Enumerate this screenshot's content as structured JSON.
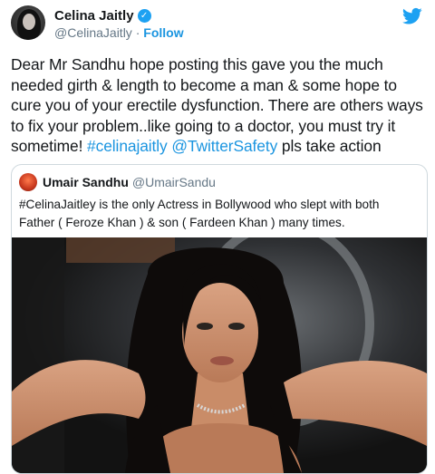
{
  "author": {
    "name": "Celina Jaitly",
    "handle": "@CelinaJaitly",
    "separator": "·",
    "follow_label": "Follow"
  },
  "tweet": {
    "text_part1": "Dear Mr Sandhu hope posting this gave you the much needed girth & length to become a man & some hope to cure you of your erectile dysfunction. There are others ways to fix your problem..like going to a doctor, you must try it sometime! ",
    "hashtag": "#celinajaitly",
    "mention": "@TwitterSafety",
    "text_part2": " pls take action"
  },
  "quoted_tweet": {
    "name": "Umair Sandhu",
    "handle": "@UmairSandu",
    "text": "#CelinaJaitley is the only Actress in Bollywood who slept with both Father ( Feroze Khan ) & son ( Fardeen Khan ) many times."
  },
  "icons": {
    "verified": "verified-badge-icon",
    "brand": "twitter-bird-icon"
  },
  "colors": {
    "link": "#1b95e0",
    "verified": "#1da1f2",
    "text": "#14171a",
    "secondary": "#657786",
    "border": "#cfd9de"
  }
}
